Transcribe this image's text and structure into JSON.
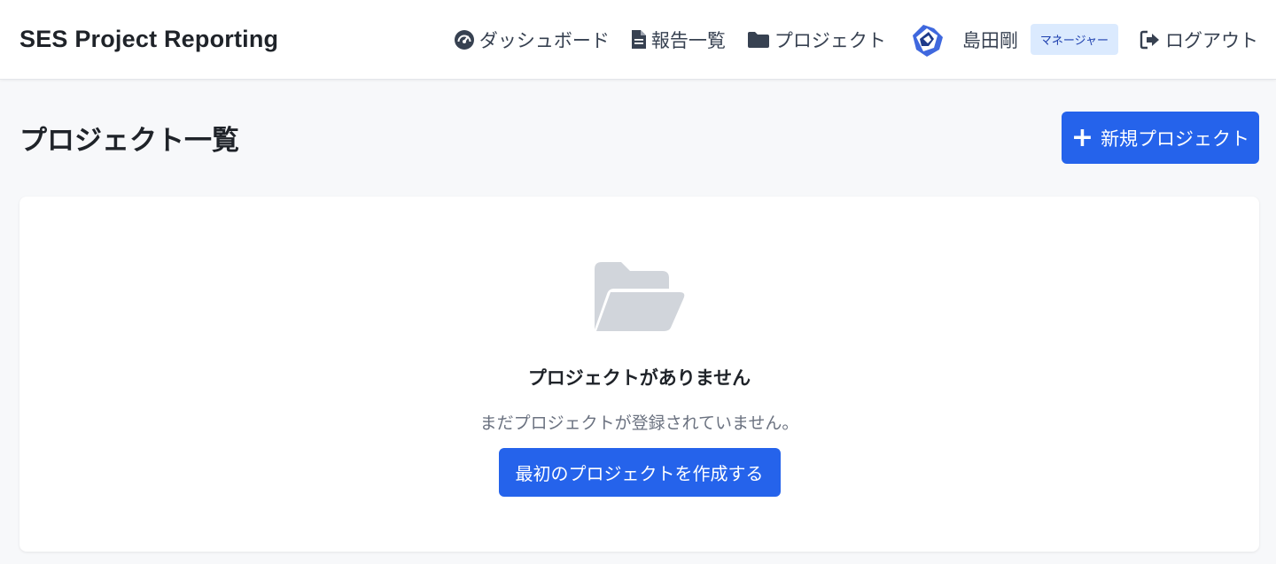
{
  "header": {
    "brand": "SES Project Reporting",
    "nav": {
      "dashboard": "ダッシュボード",
      "reports": "報告一覧",
      "projects": "プロジェクト"
    },
    "user": {
      "name": "島田剛",
      "role": "マネージャー"
    },
    "logout": "ログアウト"
  },
  "main": {
    "title": "プロジェクト一覧",
    "new_button": "新規プロジェクト",
    "new_button_icon": "+",
    "empty": {
      "title": "プロジェクトがありません",
      "description": "まだプロジェクトが登録されていません。",
      "cta": "最初のプロジェクトを作成する"
    }
  },
  "icons": {
    "dashboard": "tachometer-icon",
    "reports": "file-icon",
    "projects": "folder-icon",
    "logout": "sign-out-icon",
    "empty": "folder-open-icon"
  },
  "colors": {
    "primary": "#2563eb",
    "badge_bg": "#dbeafe",
    "badge_text": "#1e40af",
    "empty_icon": "#d1d5db",
    "page_bg": "#f7f8fa"
  }
}
